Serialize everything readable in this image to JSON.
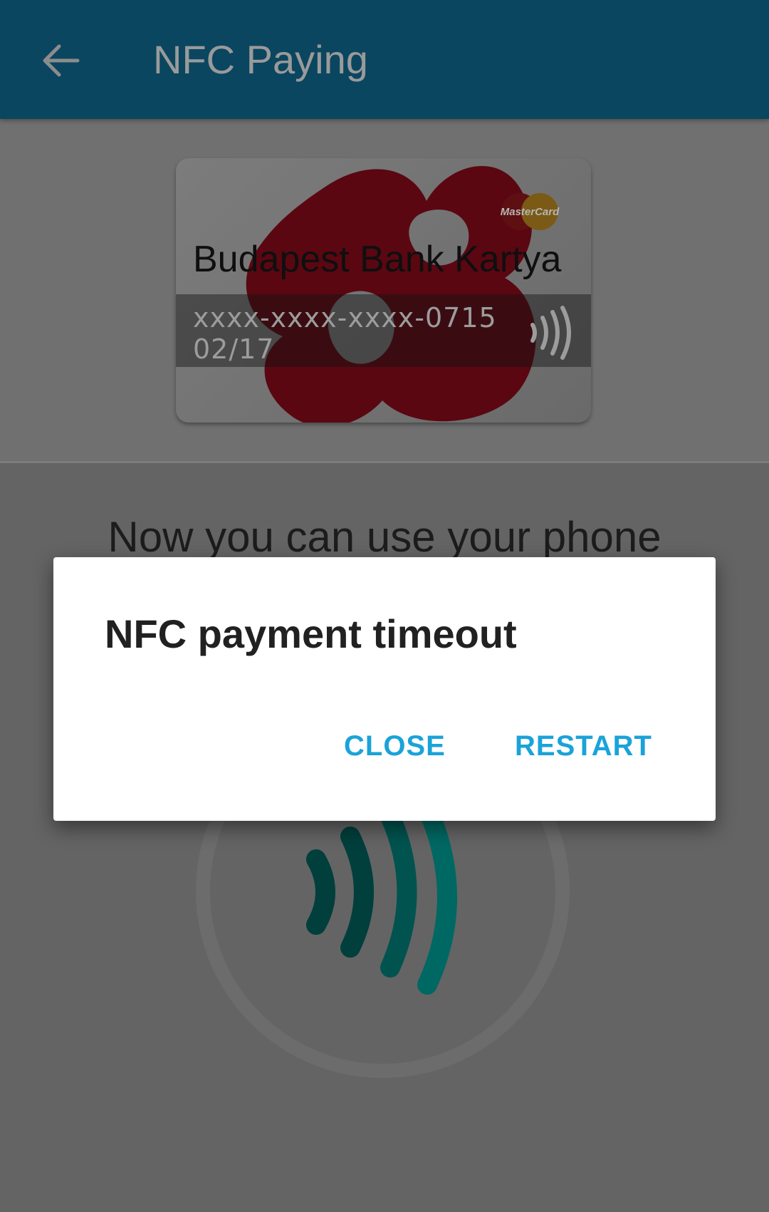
{
  "app_bar": {
    "title": "NFC Paying",
    "back_icon": "arrow-back-icon",
    "background": "#0a4660"
  },
  "card": {
    "name": "Budapest Bank Kartya",
    "number": "xxxx-xxxx-xxxx-0715",
    "expiry": "02/17",
    "bank_logo": "budapest-bank-logo",
    "brand_logo": "mastercard-logo",
    "brand_text": "MasterCard",
    "contactless_icon": "contactless-icon"
  },
  "main": {
    "instruction": "Now you can use your phone",
    "nfc_icon": "nfc-waves-icon"
  },
  "dialog": {
    "title": "NFC payment timeout",
    "close_label": "CLOSE",
    "restart_label": "RESTART",
    "accent": "#1aa3d9"
  }
}
